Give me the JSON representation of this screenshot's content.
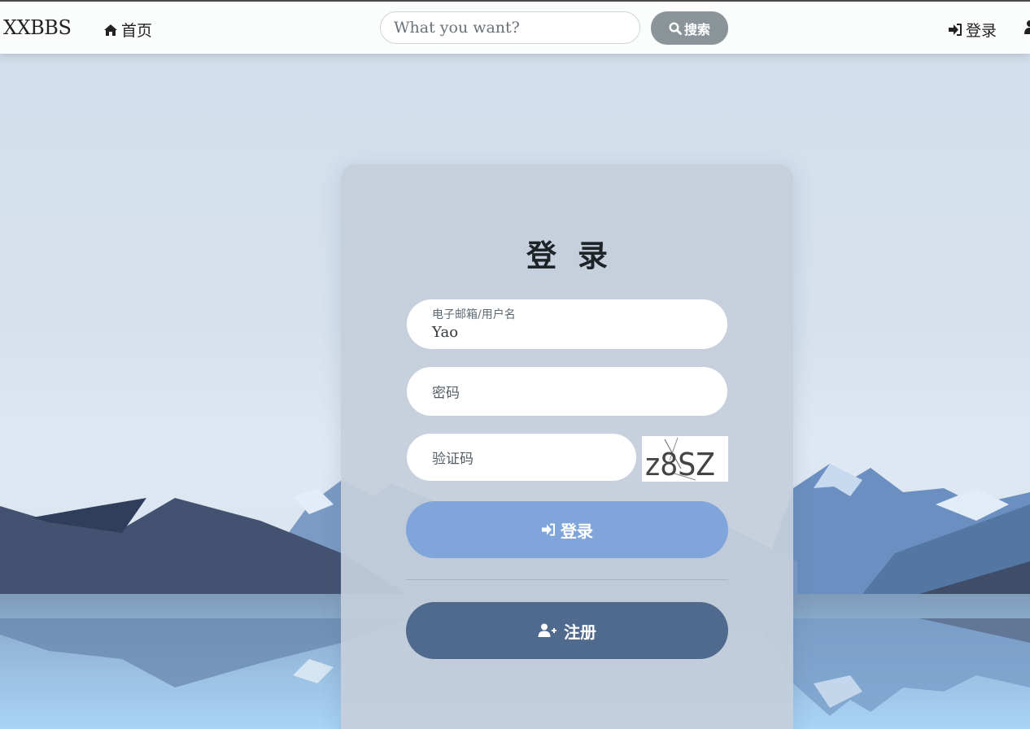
{
  "navbar": {
    "brand": "XXBBS",
    "home_label": "首页",
    "search_placeholder": "What you want?",
    "search_button_label": "搜索",
    "login_label": "登录"
  },
  "login_form": {
    "title": "登录",
    "username_label": "电子邮箱/用户名",
    "username_value": "Yao",
    "password_placeholder": "密码",
    "captcha_placeholder": "验证码",
    "captcha_text": "z8SZ",
    "login_button_label": "登录",
    "register_button_label": "注册"
  },
  "colors": {
    "login_button": "#7fa5da",
    "register_button": "#4f6a8d",
    "search_button": "#8a9499"
  }
}
